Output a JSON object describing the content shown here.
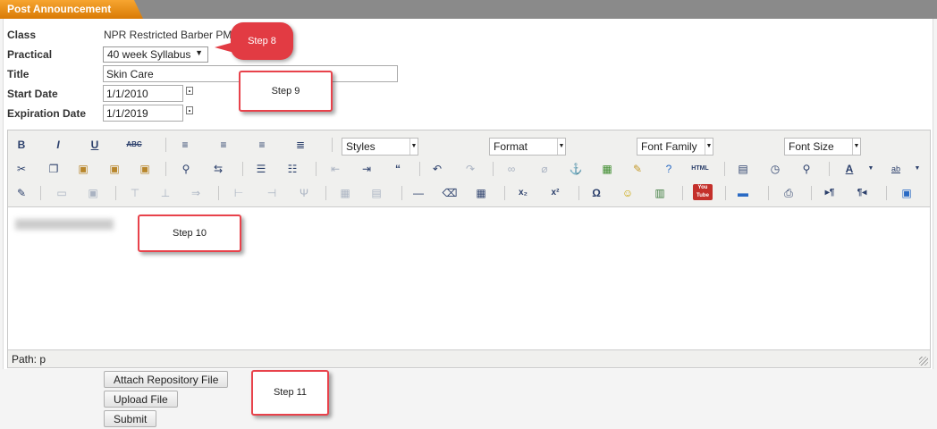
{
  "header": {
    "tab_title": "Post Announcement"
  },
  "form": {
    "class_label": "Class",
    "class_value": "NPR Restricted Barber PM",
    "practical_label": "Practical",
    "practical_value": "40 week Syllabus",
    "title_label": "Title",
    "title_value": "Skin Care",
    "start_label": "Start Date",
    "start_value": "1/1/2010",
    "exp_label": "Expiration Date",
    "exp_value": "1/1/2019"
  },
  "toolbar": {
    "styles": "Styles",
    "format": "Format",
    "font_family": "Font Family",
    "font_size": "Font Size",
    "bold": "B",
    "italic": "I",
    "underline": "U",
    "strike": "ABC",
    "html": "HTML",
    "subscript": "x₂",
    "superscript": "x²",
    "omega": "Ω",
    "youtube": "You Tube",
    "paragraph_ltr": "▸¶",
    "paragraph_rtl": "¶◂"
  },
  "editor": {
    "path_text": "Path: p"
  },
  "buttons": {
    "attach": "Attach Repository File",
    "upload": "Upload File",
    "submit": "Submit"
  },
  "annotations": {
    "step8": "Step 8",
    "step9": "Step 9",
    "step10": "Step 10",
    "step11": "Step 11"
  },
  "colors": {
    "accent": "#e8424b",
    "tab": "#f29a1f"
  }
}
